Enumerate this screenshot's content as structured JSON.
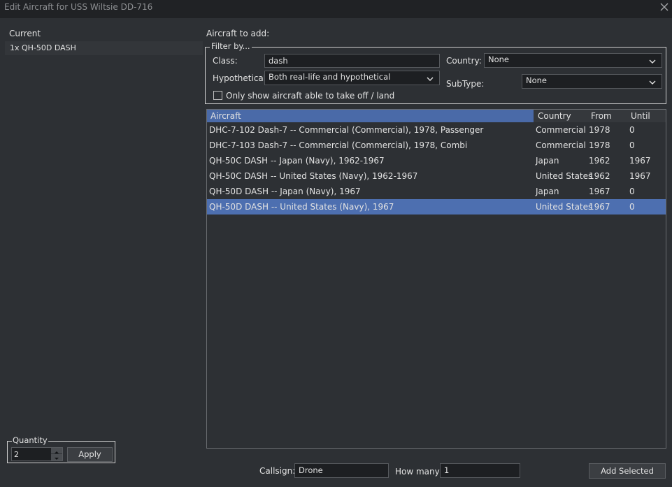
{
  "window": {
    "title": "Edit Aircraft for USS Wiltsie DD-716"
  },
  "current": {
    "label": "Current",
    "items": [
      "1x QH-50D DASH"
    ]
  },
  "quantity": {
    "legend": "Quantity",
    "value": "2",
    "apply_label": "Apply"
  },
  "add": {
    "label": "Aircraft to add:"
  },
  "filter": {
    "legend": "Filter by...",
    "class_label": "Class:",
    "class_value": "dash",
    "country_label": "Country:",
    "country_value": "None",
    "hypothetical_label": "Hypothetical:",
    "hypothetical_value": "Both real-life and hypothetical",
    "subtype_label": "SubType:",
    "subtype_value": "None",
    "takeoff_label": "Only show aircraft able to take off / land",
    "takeoff_checked": false
  },
  "table": {
    "columns": [
      "Aircraft",
      "Country",
      "From",
      "Until"
    ],
    "rows": [
      [
        "DHC-7-102 Dash-7 -- Commercial (Commercial), 1978, Passenger",
        "Commercial",
        "1978",
        "0"
      ],
      [
        "DHC-7-103 Dash-7 -- Commercial (Commercial), 1978, Combi",
        "Commercial",
        "1978",
        "0"
      ],
      [
        "QH-50C DASH -- Japan (Navy), 1962-1967",
        "Japan",
        "1962",
        "1967"
      ],
      [
        "QH-50C DASH -- United States (Navy), 1962-1967",
        "United States",
        "1962",
        "1967"
      ],
      [
        "QH-50D DASH -- Japan (Navy), 1967",
        "Japan",
        "1967",
        "0"
      ],
      [
        "QH-50D DASH -- United States (Navy), 1967",
        "United States",
        "1967",
        "0"
      ]
    ],
    "selected_row": 5
  },
  "bottom": {
    "callsign_label": "Callsign:",
    "callsign_value": "Drone",
    "howmany_label": "How many:",
    "howmany_value": "1",
    "add_selected_label": "Add Selected"
  },
  "colors": {
    "background": "#2d3034",
    "titlebar": "#202225",
    "selection": "#4d6fb0",
    "header_sorted": "#4a6aa8",
    "input_bg": "#1d1f22"
  },
  "icons": {
    "close": "close-icon",
    "chevron": "chevron-down-icon",
    "spin_up": "arrow-up-icon",
    "spin_down": "arrow-down-icon"
  }
}
